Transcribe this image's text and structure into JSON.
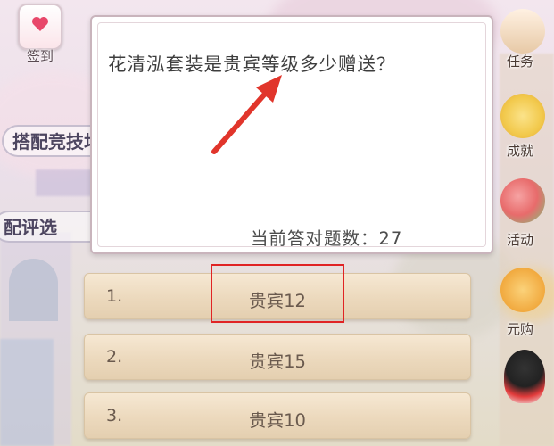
{
  "question": {
    "text": "花清泓套装是贵宾等级多少赠送？",
    "score_text": "当前答对题数：27"
  },
  "answers": [
    {
      "num": "1.",
      "text": "贵宾12"
    },
    {
      "num": "2.",
      "text": "贵宾15"
    },
    {
      "num": "3.",
      "text": "贵宾10"
    }
  ],
  "left_menu": {
    "checkin_label": "签到",
    "pill_1": "搭配竞技场",
    "pill_2": "配评选"
  },
  "right_menu": {
    "tasks_label": "任务",
    "achievements_label": "成就",
    "events_label": "活动",
    "one_yuan_label": "元购"
  },
  "colors": {
    "highlight": "#e02424",
    "arrow": "#e1352b",
    "button_fill": "#ecd9bd"
  }
}
